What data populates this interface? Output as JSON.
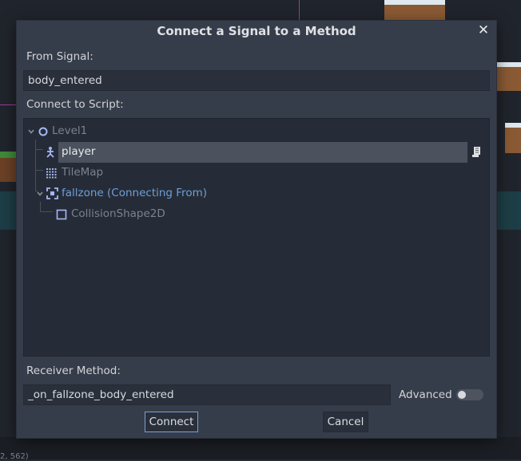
{
  "dialog": {
    "title": "Connect a Signal to a Method",
    "close_icon": "close-icon",
    "from_signal_label": "From Signal:",
    "from_signal_value": "body_entered",
    "connect_to_script_label": "Connect to Script:",
    "receiver_method_label": "Receiver Method:",
    "receiver_method_value": "_on_fallzone_body_entered",
    "advanced_label": "Advanced",
    "advanced_enabled": false,
    "connect_label": "Connect",
    "cancel_label": "Cancel"
  },
  "tree": {
    "nodes": [
      {
        "label": "Level1",
        "icon": "node2d-circle-icon",
        "state": "dimmed",
        "expanded": true
      },
      {
        "label": "player",
        "icon": "kinematic-body-icon",
        "state": "selected",
        "attached": "script-icon"
      },
      {
        "label": "TileMap",
        "icon": "tilemap-grid-icon",
        "state": "dimmed"
      },
      {
        "label": "fallzone (Connecting From)",
        "icon": "area2d-icon",
        "state": "source",
        "expanded": true
      },
      {
        "label": "CollisionShape2D",
        "icon": "collision-shape-icon",
        "state": "dimmed"
      }
    ]
  },
  "background": {
    "status_text": "2, 562)"
  },
  "colors": {
    "dialog_bg": "#363d4a",
    "field_bg": "#2a303b",
    "tree_bg": "#262c37",
    "selection_bg": "#4b525e",
    "accent_blue": "#6e9fd8",
    "dim_text": "#7c828c"
  }
}
